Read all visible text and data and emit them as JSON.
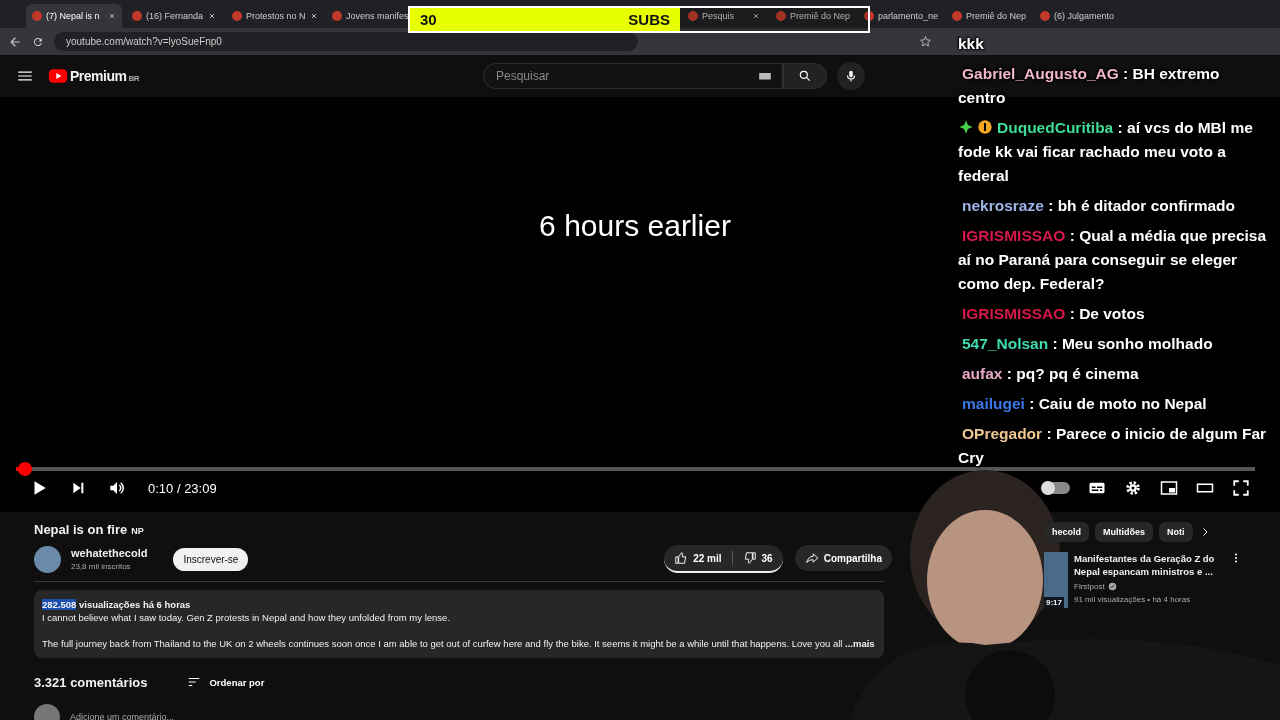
{
  "browser": {
    "tabs": [
      {
        "label": "(7) Nepal is n",
        "selected": true
      },
      {
        "label": "(16) Fernanda",
        "selected": false
      },
      {
        "label": "Protestos no N",
        "selected": false
      },
      {
        "label": "Jovens manifes",
        "selected": false
      },
      {
        "label": "Pesquis",
        "selected": false
      },
      {
        "label": "Premiê do Nep",
        "selected": false
      },
      {
        "label": "parlamento_ne",
        "selected": false
      },
      {
        "label": "Premiê do Nep",
        "selected": false
      },
      {
        "label": "(6) Julgamento",
        "selected": false
      }
    ],
    "address": "youtube.com/watch?v=lyoSueFnp0"
  },
  "header": {
    "logo": "Premium",
    "region": "BR",
    "search": {
      "placeholder": "Pesquisar"
    }
  },
  "player": {
    "overlay_text": "6 hours earlier",
    "level": 0.0072,
    "time": "0:10 / 23:09",
    "playing": false,
    "autoplay": false
  },
  "video": {
    "title": "Nepal is on fire",
    "title_suffix": "NP",
    "channel": "wehatethecold",
    "subscribers": "23,8 mil inscritos",
    "subscribe": "Inscrever-se",
    "likes": "22 mil",
    "dislikes": "36",
    "share": "Compartilha",
    "views": "282.508",
    "views_label": "visualizações",
    "age": "há 6 horas",
    "description": [
      "I cannot believe what I saw today. Gen Z protests in Nepal and how they unfolded from my lense.",
      "The full journey back from Thailand to the UK on 2 wheels continues soon once I am able to get out of curfew here and fly the bike. It seems it might be a while until that happens. Love you all"
    ],
    "more": "...mais",
    "comments_count": "3.321 comentários",
    "sort": "Ordenar por",
    "comment_placeholder": "Adicione um comentário..."
  },
  "recommendations": {
    "chips": [
      {
        "label": "hecold",
        "selected": false
      },
      {
        "label": "Multidões",
        "selected": false
      },
      {
        "label": "Noti",
        "selected": false
      }
    ],
    "videos": [
      {
        "title": "Manifestantes da Geração Z do Nepal espancam ministros e ...",
        "channel": "Firstpost",
        "meta": "91 mil visualizações • há 4 horas",
        "duration": "9:17"
      }
    ]
  },
  "subs_goal": {
    "count": "30",
    "label": "SUBS",
    "level": 0.59
  },
  "chat": [
    {
      "kind": "continuation",
      "text": "kkk"
    },
    {
      "kind": "message",
      "user": "Gabriel_Augusto_AG",
      "color": "#f2b8c8",
      "text": ": BH extremo centro",
      "badges": false
    },
    {
      "kind": "message",
      "user": "DuquedCuritiba",
      "color": "#3ddc97",
      "text": ": aí vcs do MBl me fode kk vai ficar rachado meu voto a federal",
      "badges": true
    },
    {
      "kind": "message",
      "user": "nekrosraze",
      "color": "#9fb4e8",
      "text": ": bh é ditador confirmado",
      "badges": false
    },
    {
      "kind": "message",
      "user": "IGRISMISSAO",
      "color": "#d8184a",
      "text": ": Qual a média que precisa aí no Paraná para conseguir se eleger como dep. Federal?",
      "badges": false
    },
    {
      "kind": "message",
      "user": "IGRISMISSAO",
      "color": "#d8184a",
      "text": ": De votos",
      "badges": false
    },
    {
      "kind": "message",
      "user": "547_Nolsan",
      "color": "#3ddcb0",
      "text": ": Meu sonho molhado",
      "badges": false
    },
    {
      "kind": "message",
      "user": "aufax",
      "color": "#e8a8c8",
      "text": ": pq? pq é cinema",
      "badges": false
    },
    {
      "kind": "message",
      "user": "mailugei",
      "color": "#3a78e8",
      "text": ": Caiu de moto no Nepal",
      "badges": false
    },
    {
      "kind": "message",
      "user": "OPregador",
      "color": "#f0c890",
      "text": ": Parece o inicio de algum Far Cry",
      "badges": false
    }
  ]
}
